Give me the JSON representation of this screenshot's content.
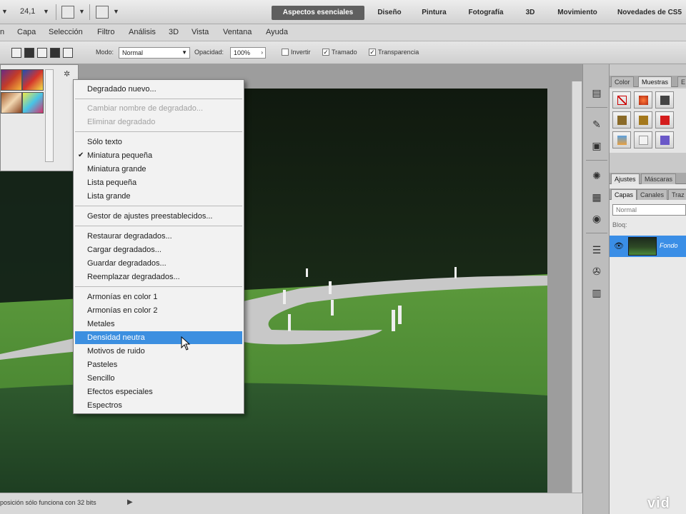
{
  "app_bar": {
    "zoom": "24,1",
    "workspaces": [
      {
        "label": "Aspectos esenciales",
        "active": true
      },
      {
        "label": "Diseño",
        "active": false
      },
      {
        "label": "Pintura",
        "active": false
      },
      {
        "label": "Fotografía",
        "active": false
      },
      {
        "label": "3D",
        "active": false
      },
      {
        "label": "Movimiento",
        "active": false
      },
      {
        "label": "Novedades de CS5",
        "active": false
      }
    ]
  },
  "menu": {
    "items": [
      "n",
      "Capa",
      "Selección",
      "Filtro",
      "Análisis",
      "3D",
      "Vista",
      "Ventana",
      "Ayuda"
    ]
  },
  "options": {
    "mode_label": "Modo:",
    "mode_value": "Normal",
    "opacity_label": "Opacidad:",
    "opacity_value": "100%",
    "invert_label": "Invertir",
    "dither_label": "Tramado",
    "transparency_label": "Transparencia"
  },
  "dropdown": {
    "groups": [
      [
        {
          "label": "Degradado nuevo...",
          "disabled": false
        }
      ],
      [
        {
          "label": "Cambiar nombre de degradado...",
          "disabled": true
        },
        {
          "label": "Eliminar degradado",
          "disabled": true
        }
      ],
      [
        {
          "label": "Sólo texto",
          "checked": false
        },
        {
          "label": "Miniatura pequeña",
          "checked": true
        },
        {
          "label": "Miniatura grande",
          "checked": false
        },
        {
          "label": "Lista pequeña",
          "checked": false
        },
        {
          "label": "Lista grande",
          "checked": false
        }
      ],
      [
        {
          "label": "Gestor de ajustes preestablecidos..."
        }
      ],
      [
        {
          "label": "Restaurar degradados..."
        },
        {
          "label": "Cargar degradados..."
        },
        {
          "label": "Guardar degradados..."
        },
        {
          "label": "Reemplazar degradados..."
        }
      ],
      [
        {
          "label": "Armonías en color 1"
        },
        {
          "label": "Armonías en color 2"
        },
        {
          "label": "Metales"
        },
        {
          "label": "Densidad neutra",
          "highlighted": true
        },
        {
          "label": "Motivos de ruido"
        },
        {
          "label": "Pasteles"
        },
        {
          "label": "Sencillo"
        },
        {
          "label": "Efectos especiales"
        },
        {
          "label": "Espectros"
        }
      ]
    ]
  },
  "right_panels": {
    "top_tabs": [
      "Color",
      "Muestras",
      "E"
    ],
    "adjust_tabs": [
      "Ajustes",
      "Máscaras"
    ],
    "layer_tabs": [
      "Capas",
      "Canales",
      "Traz"
    ],
    "blend_mode": "Normal",
    "lock_label": "Bloq:",
    "layer_name": "Fondo"
  },
  "status": {
    "text": "posición sólo funciona con 32 bits"
  },
  "watermark": "vid",
  "colors": {
    "accent_blue": "#3c8fe0",
    "layer_selected": "#3a8ee6",
    "menu_bg": "#f2f2f2"
  },
  "icons": [
    "dropdown-arrow-icon",
    "screen-mode-icon",
    "extras-icon",
    "gear-icon",
    "check-icon",
    "cursor-icon",
    "eye-icon",
    "history-icon",
    "brush-icon",
    "clone-icon",
    "info-icon",
    "layers-icon"
  ]
}
